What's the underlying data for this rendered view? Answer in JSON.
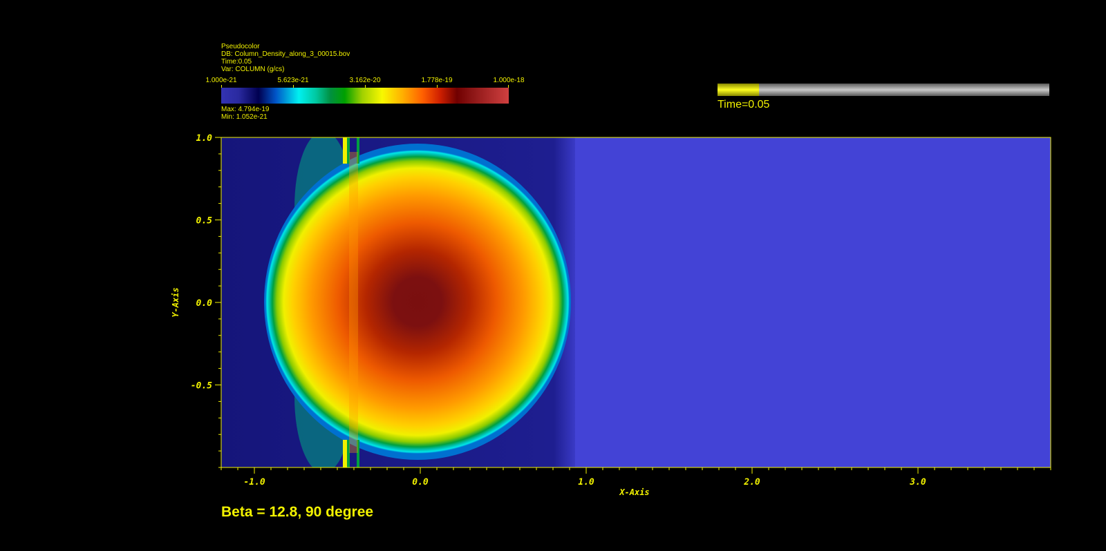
{
  "legend": {
    "title": "Pseudocolor",
    "db": "DB: Column_Density_along_3_00015.bov",
    "time": "Time:0.05",
    "var": "Var: COLUMN (g/cs)",
    "colorbar_ticks": [
      "1.000e-21",
      "5.623e-21",
      "3.162e-20",
      "1.778e-19",
      "1.000e-18"
    ],
    "max": "Max:  4.794e-19",
    "min": "Min:  1.052e-21"
  },
  "time_slider": {
    "label": "Time=0.05",
    "progress": 0.125,
    "fill_color": "#ffff20"
  },
  "plot": {
    "x_axis_title": "X-Axis",
    "y_axis_title": "Y-Axis",
    "x_ticks": [
      {
        "value": -1.0,
        "label": "-1.0"
      },
      {
        "value": 0.0,
        "label": "0.0"
      },
      {
        "value": 1.0,
        "label": "1.0"
      },
      {
        "value": 2.0,
        "label": "2.0"
      },
      {
        "value": 3.0,
        "label": "3.0"
      }
    ],
    "y_ticks": [
      {
        "value": 1.0,
        "label": "1.0"
      },
      {
        "value": 0.5,
        "label": "0.5"
      },
      {
        "value": 0.0,
        "label": "0.0"
      },
      {
        "value": -0.5,
        "label": "-0.5"
      }
    ],
    "x_range": [
      -1.2,
      3.8
    ],
    "y_range": [
      -1.0,
      1.0
    ],
    "background_color": "#4343d6",
    "axis_color": "#f2f200"
  },
  "caption": "Beta = 12.8, 90 degree"
}
